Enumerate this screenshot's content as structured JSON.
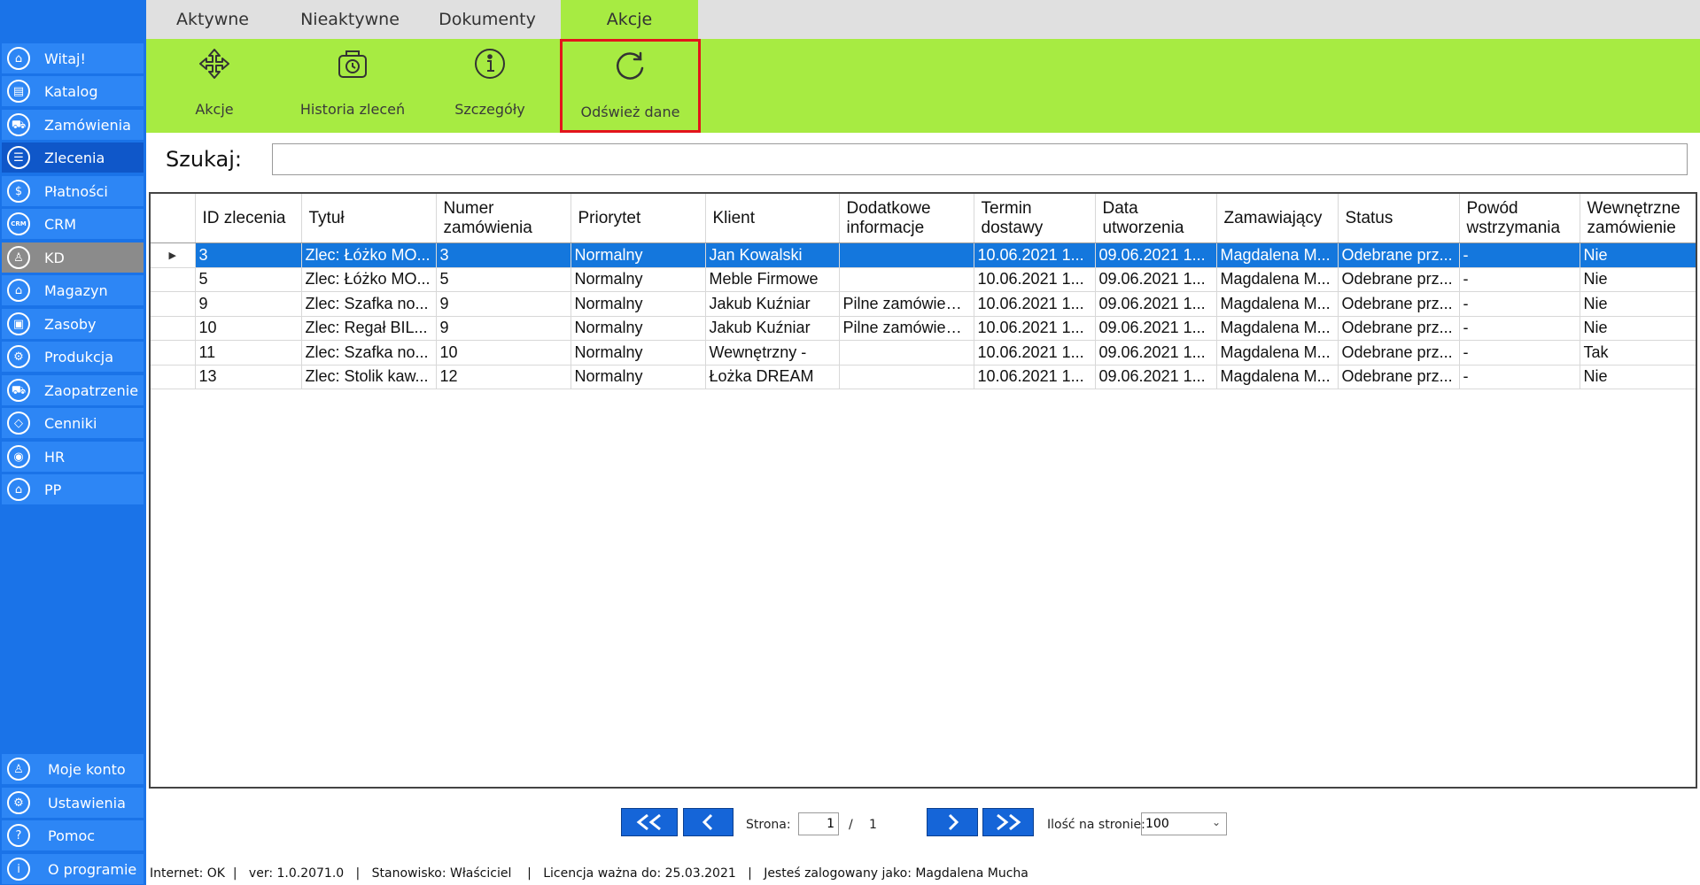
{
  "sidebar": {
    "items": [
      {
        "label": "Witaj!",
        "icon": "home-icon",
        "glyph": "⌂"
      },
      {
        "label": "Katalog",
        "icon": "book-icon",
        "glyph": "▤"
      },
      {
        "label": "Zamówienia",
        "icon": "cart-icon",
        "glyph": "⛟"
      },
      {
        "label": "Zlecenia",
        "icon": "list-icon",
        "glyph": "☰"
      },
      {
        "label": "Płatności",
        "icon": "dollar-icon",
        "glyph": "$"
      },
      {
        "label": "CRM",
        "icon": "crm-icon",
        "glyph": "CRM"
      },
      {
        "label": "KD",
        "icon": "person-icon",
        "glyph": "♙"
      },
      {
        "label": "Magazyn",
        "icon": "warehouse-icon",
        "glyph": "⌂"
      },
      {
        "label": "Zasoby",
        "icon": "box-icon",
        "glyph": "▣"
      },
      {
        "label": "Produkcja",
        "icon": "gears-icon",
        "glyph": "⚙"
      },
      {
        "label": "Zaopatrzenie",
        "icon": "truck-icon",
        "glyph": "⛟"
      },
      {
        "label": "Cenniki",
        "icon": "tag-icon",
        "glyph": "◇"
      },
      {
        "label": "HR",
        "icon": "hr-icon",
        "glyph": "◉"
      },
      {
        "label": "PP",
        "icon": "factory-icon",
        "glyph": "⌂"
      }
    ],
    "bottom": [
      {
        "label": "Moje konto",
        "icon": "account-icon",
        "glyph": "♙"
      },
      {
        "label": "Ustawienia",
        "icon": "settings-icon",
        "glyph": "⚙"
      },
      {
        "label": "Pomoc",
        "icon": "help-icon",
        "glyph": "?"
      },
      {
        "label": "O programie",
        "icon": "info-icon",
        "glyph": "i"
      }
    ]
  },
  "tabs": [
    {
      "label": "Aktywne"
    },
    {
      "label": "Nieaktywne"
    },
    {
      "label": "Dokumenty"
    },
    {
      "label": "Akcje"
    }
  ],
  "ribbon": {
    "buttons": [
      {
        "label": "Akcje",
        "icon": "move-arrows-icon"
      },
      {
        "label": "Historia zleceń",
        "icon": "history-bag-icon"
      },
      {
        "label": "Szczegóły",
        "icon": "info-circle-icon"
      },
      {
        "label": "Odśwież dane",
        "icon": "refresh-icon"
      }
    ]
  },
  "search": {
    "label": "Szukaj:",
    "value": ""
  },
  "table": {
    "columns": [
      {
        "label": "ID zlecenia"
      },
      {
        "label": "Tytuł"
      },
      {
        "label": "Numer zamówienia"
      },
      {
        "label": "Priorytet"
      },
      {
        "label": "Klient"
      },
      {
        "label": "Dodatkowe informacje"
      },
      {
        "label": "Termin dostawy"
      },
      {
        "label": "Data utworzenia"
      },
      {
        "label": "Zamawiający"
      },
      {
        "label": "Status"
      },
      {
        "label": "Powód wstrzymania"
      },
      {
        "label": "Wewnętrzne zamówienie"
      }
    ],
    "rows": [
      {
        "cells": [
          "3",
          "Zlec: Łóżko MO...",
          "3",
          "Normalny",
          "Jan Kowalski",
          "",
          "10.06.2021 1...",
          "09.06.2021 1...",
          "Magdalena M...",
          "Odebrane prz...",
          "-",
          "Nie"
        ]
      },
      {
        "cells": [
          "5",
          "Zlec: Łóżko MO...",
          "5",
          "Normalny",
          "Meble Firmowe",
          "",
          "10.06.2021 1...",
          "09.06.2021 1...",
          "Magdalena M...",
          "Odebrane prz...",
          "-",
          "Nie"
        ]
      },
      {
        "cells": [
          "9",
          "Zlec: Szafka no...",
          "9",
          "Normalny",
          "Jakub Kuźniar",
          "Pilne zamówienie!",
          "10.06.2021 1...",
          "09.06.2021 1...",
          "Magdalena M...",
          "Odebrane prz...",
          "-",
          "Nie"
        ]
      },
      {
        "cells": [
          "10",
          "Zlec: Regał BIL...",
          "9",
          "Normalny",
          "Jakub Kuźniar",
          "Pilne zamówienie!",
          "10.06.2021 1...",
          "09.06.2021 1...",
          "Magdalena M...",
          "Odebrane prz...",
          "-",
          "Nie"
        ]
      },
      {
        "cells": [
          "11",
          "Zlec: Szafka no...",
          "10",
          "Normalny",
          "Wewnętrzny -",
          "",
          "10.06.2021 1...",
          "09.06.2021 1...",
          "Magdalena M...",
          "Odebrane prz...",
          "-",
          "Tak"
        ]
      },
      {
        "cells": [
          "13",
          "Zlec: Stolik kaw...",
          "12",
          "Normalny",
          "Łożka DREAM",
          "",
          "10.06.2021 1...",
          "09.06.2021 1...",
          "Magdalena M...",
          "Odebrane prz...",
          "-",
          "Nie"
        ]
      }
    ]
  },
  "pager": {
    "page_label": "Strona:",
    "current_page": "1",
    "separator": "/",
    "total_pages": "1",
    "per_page_label": "Ilość na stronie:",
    "per_page_value": "100"
  },
  "statusbar": {
    "text": "Internet: OK  |   ver: 1.0.2071.0   |   Stanowisko: Właściciel    |   Licencja ważna do: 25.03.2021   |   Jesteś zalogowany jako: Magdalena Mucha"
  },
  "colors": {
    "sidebar": "#1a73e8",
    "accent_green": "#a7eb42",
    "selection": "#1477dd",
    "highlight_border": "#e3141b"
  }
}
